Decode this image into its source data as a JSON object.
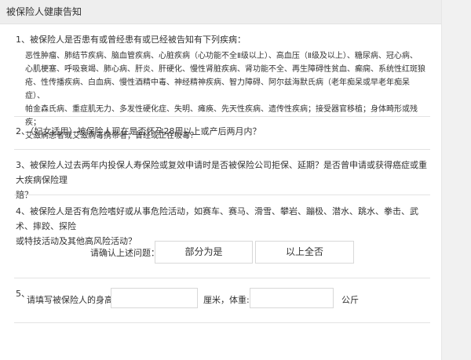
{
  "header": {
    "title": "被保险人健康告知"
  },
  "questions": {
    "q1": {
      "text": "1、被保险人是否患有或曾经患有或已经被告知有下列疾病：",
      "diseases": [
        "恶性肿瘤、肺结节疾病、脑血管疾病、心脏疾病（心功能不全Ⅱ级以上）、高血压（Ⅱ级及以上）、糖尿病、冠心病、",
        "心肌梗塞、呼吸衰竭、肺心病、肝炎、肝硬化、慢性肾脏疾病、肾功能不全、再生障碍性贫血、癫痫、系统性红斑狼",
        "疮、性传播疾病、白血病、慢性酒精中毒、神经精神疾病、智力障碍、阿尔兹海默氏病（老年痴呆或早老年痴呆症）、",
        "帕金森氏病、重症肌无力、多发性硬化症、失明、瘫痪、先天性疾病、遗传性疾病；接受器官移植；身体畸形或残疾；",
        "艾滋病患者或艾滋病毒携带者；曾经或正在吸毒？"
      ]
    },
    "q2": {
      "text": "2、（妇女适用）被保险人现在是否怀孕28周以上或产后两月内？"
    },
    "q3": {
      "line1": "3、被保险人过去两年内投保人寿保险或复效申请时是否被保险公司拒保、延期？是否曾申请或获得癌症或重大疾病保险理",
      "line2": "赔？"
    },
    "q4": {
      "line1": "4、被保险人是否有危险嗜好或从事危险活动，如赛车、赛马、滑雪、攀岩、蹦极、潜水、跳水、拳击、武术、摔跤、探险",
      "line2": "或特技活动及其他高风险活动？"
    },
    "confirm": {
      "label": "请确认上述问题：",
      "option_partial": "部分为是",
      "option_none": "以上全否"
    },
    "q5": {
      "number": "5、",
      "label": "请填写被保险人的身高:",
      "height_value": "",
      "height_unit": "厘米，体重:",
      "weight_value": "",
      "weight_unit": "公斤"
    }
  }
}
